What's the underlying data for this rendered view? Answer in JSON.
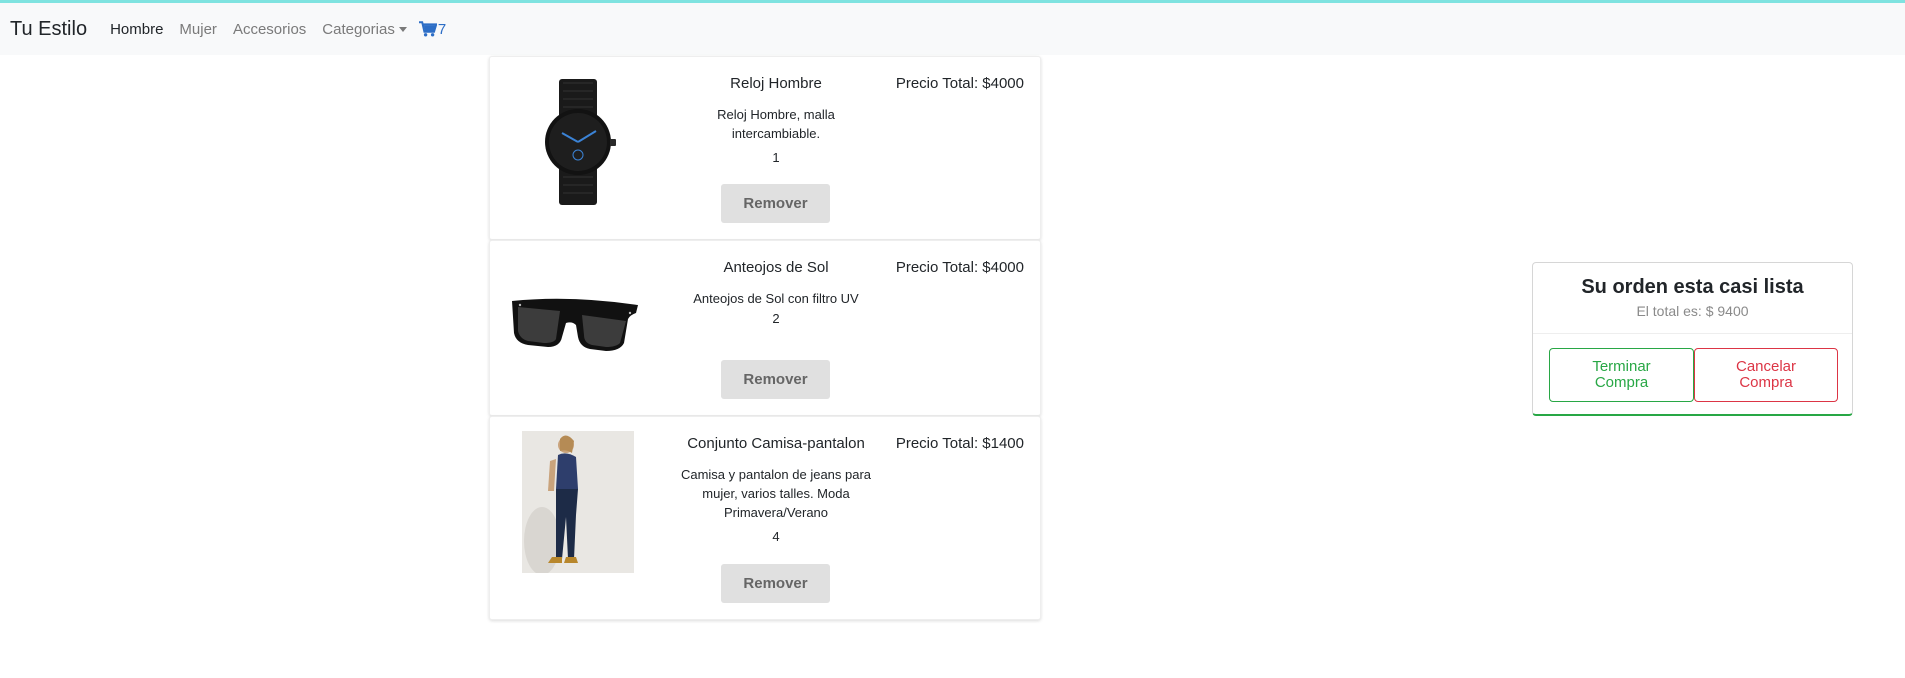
{
  "navbar": {
    "brand": "Tu Estilo",
    "links": [
      "Hombre",
      "Mujer",
      "Accesorios",
      "Categorias"
    ],
    "active_link": "Hombre",
    "cart_count": "7",
    "cart_icon": "shopping-cart-icon"
  },
  "cart_items": [
    {
      "name": "Reloj Hombre",
      "description": "Reloj Hombre, malla intercambiable.",
      "quantity": "1",
      "price_text": "Precio Total: $4000",
      "remove_label": "Remover"
    },
    {
      "name": "Anteojos de Sol",
      "description": "Anteojos de Sol con filtro UV",
      "quantity": "2",
      "price_text": "Precio Total: $4000",
      "remove_label": "Remover"
    },
    {
      "name": "Conjunto Camisa-pantalon",
      "description": "Camisa y pantalon de jeans para mujer, varios talles. Moda Primavera/Verano",
      "quantity": "4",
      "price_text": "Precio Total: $1400",
      "remove_label": "Remover"
    }
  ],
  "order_summary": {
    "title": "Su orden esta casi lista",
    "total_text": "El total es: $ 9400",
    "finish_label": "Terminar Compra",
    "cancel_label": "Cancelar Compra"
  },
  "colors": {
    "accent_line": "#7fe3e0",
    "cart_blue": "#2d6ec6",
    "success": "#28a745",
    "danger": "#dc3545"
  }
}
